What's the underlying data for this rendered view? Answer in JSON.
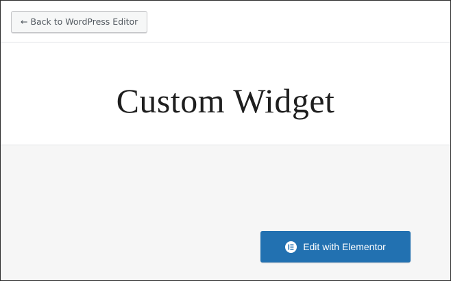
{
  "toolbar": {
    "back_label": "← Back to WordPress Editor"
  },
  "page": {
    "title": "Custom Widget"
  },
  "elementor": {
    "edit_label": "Edit with Elementor",
    "icon": "elementor-logo-icon"
  },
  "colors": {
    "primary_button": "#2271b1",
    "editor_background": "#f6f6f6",
    "divider": "#e2e4e7"
  }
}
